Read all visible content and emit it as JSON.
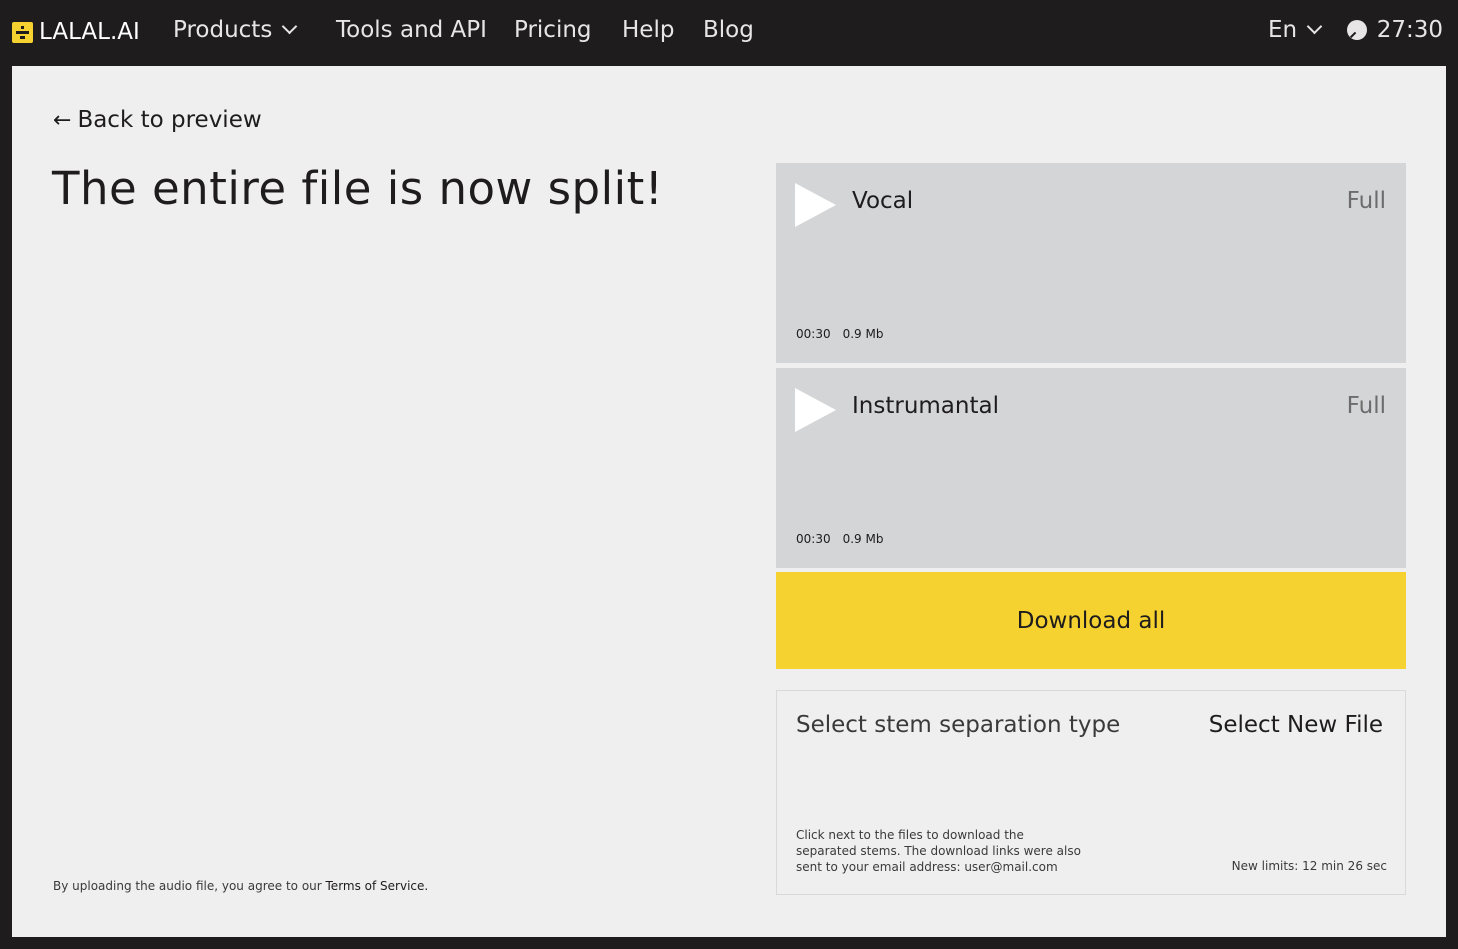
{
  "header": {
    "logo_text": "LALAL.AI",
    "nav": [
      {
        "label": "Products",
        "dropdown": true
      },
      {
        "label": "Tools and API"
      },
      {
        "label": "Pricing"
      },
      {
        "label": "Help"
      },
      {
        "label": "Blog"
      }
    ],
    "language": "En",
    "timer": "27:30"
  },
  "main": {
    "back_label": "Back to preview",
    "headline": "The entire file is now split!",
    "terms_prefix": "By uploading the audio file, you agree to our ",
    "terms_link": "Terms of Service."
  },
  "stems": [
    {
      "name": "Vocal",
      "quality": "Full",
      "duration": "00:30",
      "size": "0.9 Mb"
    },
    {
      "name": "Instrumantal",
      "quality": "Full",
      "duration": "00:30",
      "size": "0.9 Mb"
    }
  ],
  "download_all_label": "Download all",
  "panel": {
    "select_type_label": "Select stem separation type",
    "select_new_file_label": "Select New File",
    "note": "Click  next to the files to download the separated stems. The download links were also sent to your email address: user@mail.com",
    "limits": "New limits: 12 min 26 sec"
  },
  "colors": {
    "accent": "#f6d230",
    "dark": "#1e1c1d",
    "card": "#d4d5d6",
    "background": "#efefef"
  },
  "icons": {
    "logo": "lalal-logo-icon",
    "chevron": "chevron-down-icon",
    "clock": "clock-icon",
    "back": "arrow-left-icon",
    "play": "play-icon"
  }
}
